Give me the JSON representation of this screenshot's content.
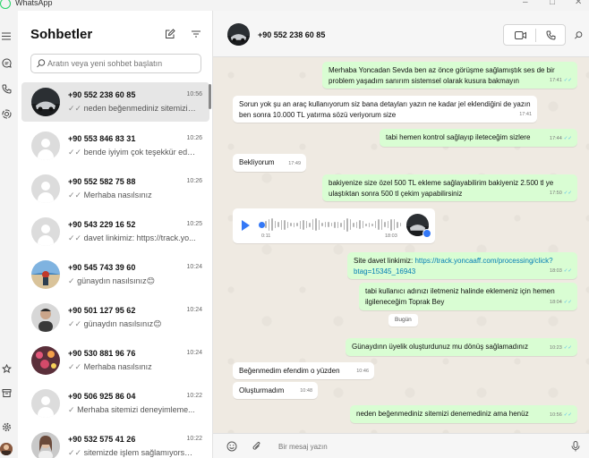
{
  "window": {
    "title": "WhatsApp",
    "minimize_glyph": "–",
    "maximize_glyph": "□",
    "close_glyph": "✕"
  },
  "rail": {
    "icons": [
      "menu-icon",
      "chats-icon",
      "calls-icon",
      "status-icon",
      "starred-icon",
      "archive-icon",
      "settings-icon",
      "profile-avatar"
    ]
  },
  "sidebar": {
    "title": "Sohbetler",
    "new_chat_icon": "new-chat-icon",
    "filter_icon": "filter-icon",
    "search_placeholder": "Aratın veya yeni sohbet başlatın",
    "chats": [
      {
        "name": "+90 552 238 60 85",
        "time": "10:56",
        "ticks": "✓✓",
        "preview": "neden beğenmediniz sitemizi d...",
        "avatar": "photo-dark-car",
        "active": true
      },
      {
        "name": "+90 553 846 83 31",
        "time": "10:26",
        "ticks": "✓✓",
        "preview": "bende iyiyim çok teşekkür eder...",
        "avatar": "default"
      },
      {
        "name": "+90 552 582 75 88",
        "time": "10:26",
        "ticks": "✓✓",
        "preview": "Merhaba nasılsınız",
        "avatar": "default"
      },
      {
        "name": "+90 543 229 16 52",
        "time": "10:25",
        "ticks": "✓✓",
        "preview": "davet linkimiz: https://track.yo...",
        "avatar": "default"
      },
      {
        "name": "+90 545 743 39 60",
        "time": "10:24",
        "ticks": "✓",
        "preview": "günaydın nasılsınız😊",
        "avatar": "photo-beach"
      },
      {
        "name": "+90 501 127 95 62",
        "time": "10:24",
        "ticks": "✓✓",
        "preview": "günaydın nasılsınız😊",
        "avatar": "photo-man"
      },
      {
        "name": "+90 530 881 96 76",
        "time": "10:24",
        "ticks": "✓✓",
        "preview": "Merhaba nasılsınız",
        "avatar": "photo-flowers"
      },
      {
        "name": "+90 506 925 86 04",
        "time": "10:22",
        "ticks": "✓",
        "preview": "Merhaba sitemizi deneyimleme...",
        "avatar": "default"
      },
      {
        "name": "+90 532 575 41 26",
        "time": "10:22",
        "ticks": "✓✓",
        "preview": "sitemizde işlem sağlamıyorsun...",
        "avatar": "photo-woman"
      }
    ]
  },
  "chat": {
    "contact_name": "+90 552 238 60 85",
    "header_icons": [
      "video-call-icon",
      "voice-call-icon",
      "search-icon"
    ],
    "date_chip": "Bugün",
    "messages": [
      {
        "dir": "out",
        "text": "Merhaba Yoncadan Sevda ben az önce görüşme sağlamıştık ses de bir problem yaşadım sanırım sistemsel olarak kusura bakmayın",
        "time": "17:41",
        "ticks": "✓✓"
      },
      {
        "dir": "in",
        "text": "Sorun yok şu an araç kullanıyorum siz bana detayları yazın ne kadar jel eklendiğini de yazın ben sonra 10.000 TL yatırma sözü veriyorum size",
        "time": "17:41"
      },
      {
        "dir": "out",
        "text": "tabi hemen kontrol sağlayıp ileteceğim sizlere",
        "time": "17:44",
        "ticks": "✓✓"
      },
      {
        "dir": "in",
        "text": "Bekliyorum",
        "time": "17:49"
      },
      {
        "dir": "out",
        "text": "bakiyenize size özel  500 TL ekleme sağlayabilirim  bakiyeniz 2.500 tl ye ulaştıktan sonra  500 tl çekim yapabilirsiniz",
        "time": "17:50",
        "ticks": "✓✓"
      },
      {
        "dir": "out",
        "text": "Site davet linkimiz:",
        "link": "https://track.yoncaaff.com/processing/click?btag=15345_16943",
        "time": "18:03",
        "ticks": "✓✓"
      },
      {
        "dir": "out",
        "text": "tabi kullanıcı adınızı iletmeniz halinde eklemeniz için hemen ilgileneceğim Toprak Bey",
        "time": "18:04",
        "ticks": "✓✓"
      },
      {
        "dir": "out",
        "text": "Günaydınn üyelik oluşturdunuz mu dönüş sağlamadınız",
        "time": "10:23",
        "ticks": "✓✓"
      },
      {
        "dir": "in",
        "text": "Beğenmedim efendim o yüzden",
        "time": "10:46"
      },
      {
        "dir": "in",
        "text": "Oluşturmadım",
        "time": "10:48"
      },
      {
        "dir": "out",
        "text": "neden beğenmediniz sitemizi denemediniz ama henüz",
        "time": "10:56",
        "ticks": "✓✓"
      }
    ],
    "voice_note": {
      "elapsed": "0:11",
      "time": "18:03",
      "progress": 0.0
    },
    "compose": {
      "placeholder": "Bir mesaj yazın",
      "icons": [
        "emoji-icon",
        "attach-icon",
        "microphone-icon"
      ]
    }
  }
}
